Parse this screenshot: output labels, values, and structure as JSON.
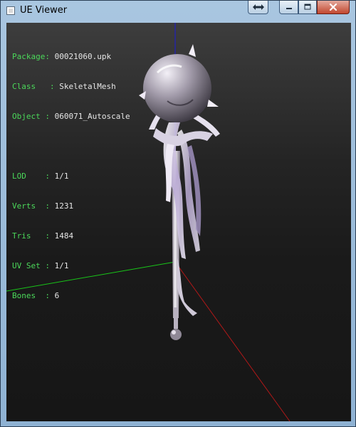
{
  "window": {
    "title": "UE Viewer",
    "controls": {
      "restore": "restore-arrows-icon",
      "minimize": "minimize-icon",
      "maximize": "maximize-icon",
      "close": "close-x-icon"
    }
  },
  "info": {
    "package_label": "Package:",
    "package": "00021060.upk",
    "class_label": "Class",
    "class": "SkeletalMesh",
    "object_label": "Object",
    "object": "060071_Autoscale",
    "lod_label": "LOD",
    "lod": "1/1",
    "verts_label": "Verts",
    "verts": "1231",
    "tris_label": "Tris",
    "tris": "1484",
    "uvset_label": "UV Set",
    "uvset": "1/1",
    "bones_label": "Bones",
    "bones": "6",
    "separator": ":"
  },
  "scene": {
    "axis_x_color": "#b01818",
    "axis_y_color": "#19c419",
    "axis_z_color": "#1a1ad8",
    "background_top": "#3d3d3d",
    "background_bottom": "#161616"
  }
}
